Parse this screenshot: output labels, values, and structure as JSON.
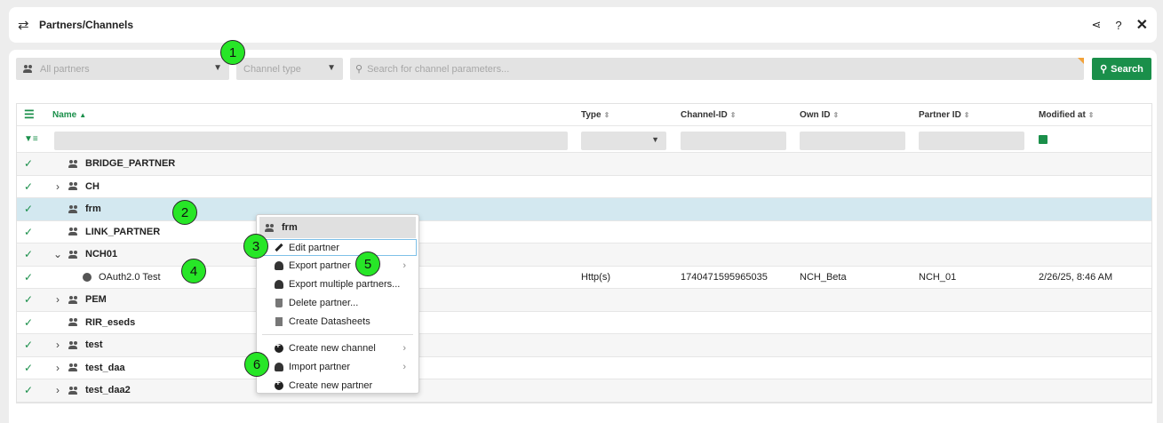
{
  "header": {
    "title": "Partners/Channels"
  },
  "filters": {
    "partners_placeholder": "All partners",
    "channel_type_placeholder": "Channel type",
    "search_placeholder": "Search for channel parameters...",
    "search_button": "Search"
  },
  "table": {
    "columns": {
      "name": "Name",
      "type": "Type",
      "channel_id": "Channel-ID",
      "own_id": "Own ID",
      "partner_id": "Partner ID",
      "modified_at": "Modified at"
    },
    "rows": [
      {
        "name": "BRIDGE_PARTNER"
      },
      {
        "name": "CH"
      },
      {
        "name": "frm"
      },
      {
        "name": "LINK_PARTNER"
      },
      {
        "name": "NCH01"
      },
      {
        "name": "OAuth2.0 Test",
        "type": "Http(s)",
        "channel_id": "1740471595965035",
        "own_id": "NCH_Beta",
        "partner_id": "NCH_01",
        "modified_at": "2/26/25, 8:46 AM"
      },
      {
        "name": "PEM"
      },
      {
        "name": "RIR_eseds"
      },
      {
        "name": "test"
      },
      {
        "name": "test_daa"
      },
      {
        "name": "test_daa2"
      }
    ]
  },
  "context_menu": {
    "title": "frm",
    "items": [
      "Edit partner",
      "Export partner",
      "Export multiple partners...",
      "Delete partner...",
      "Create Datasheets",
      "Create new channel",
      "Import partner",
      "Create new partner"
    ]
  },
  "annotations": [
    "1",
    "2",
    "3",
    "4",
    "5",
    "6"
  ]
}
